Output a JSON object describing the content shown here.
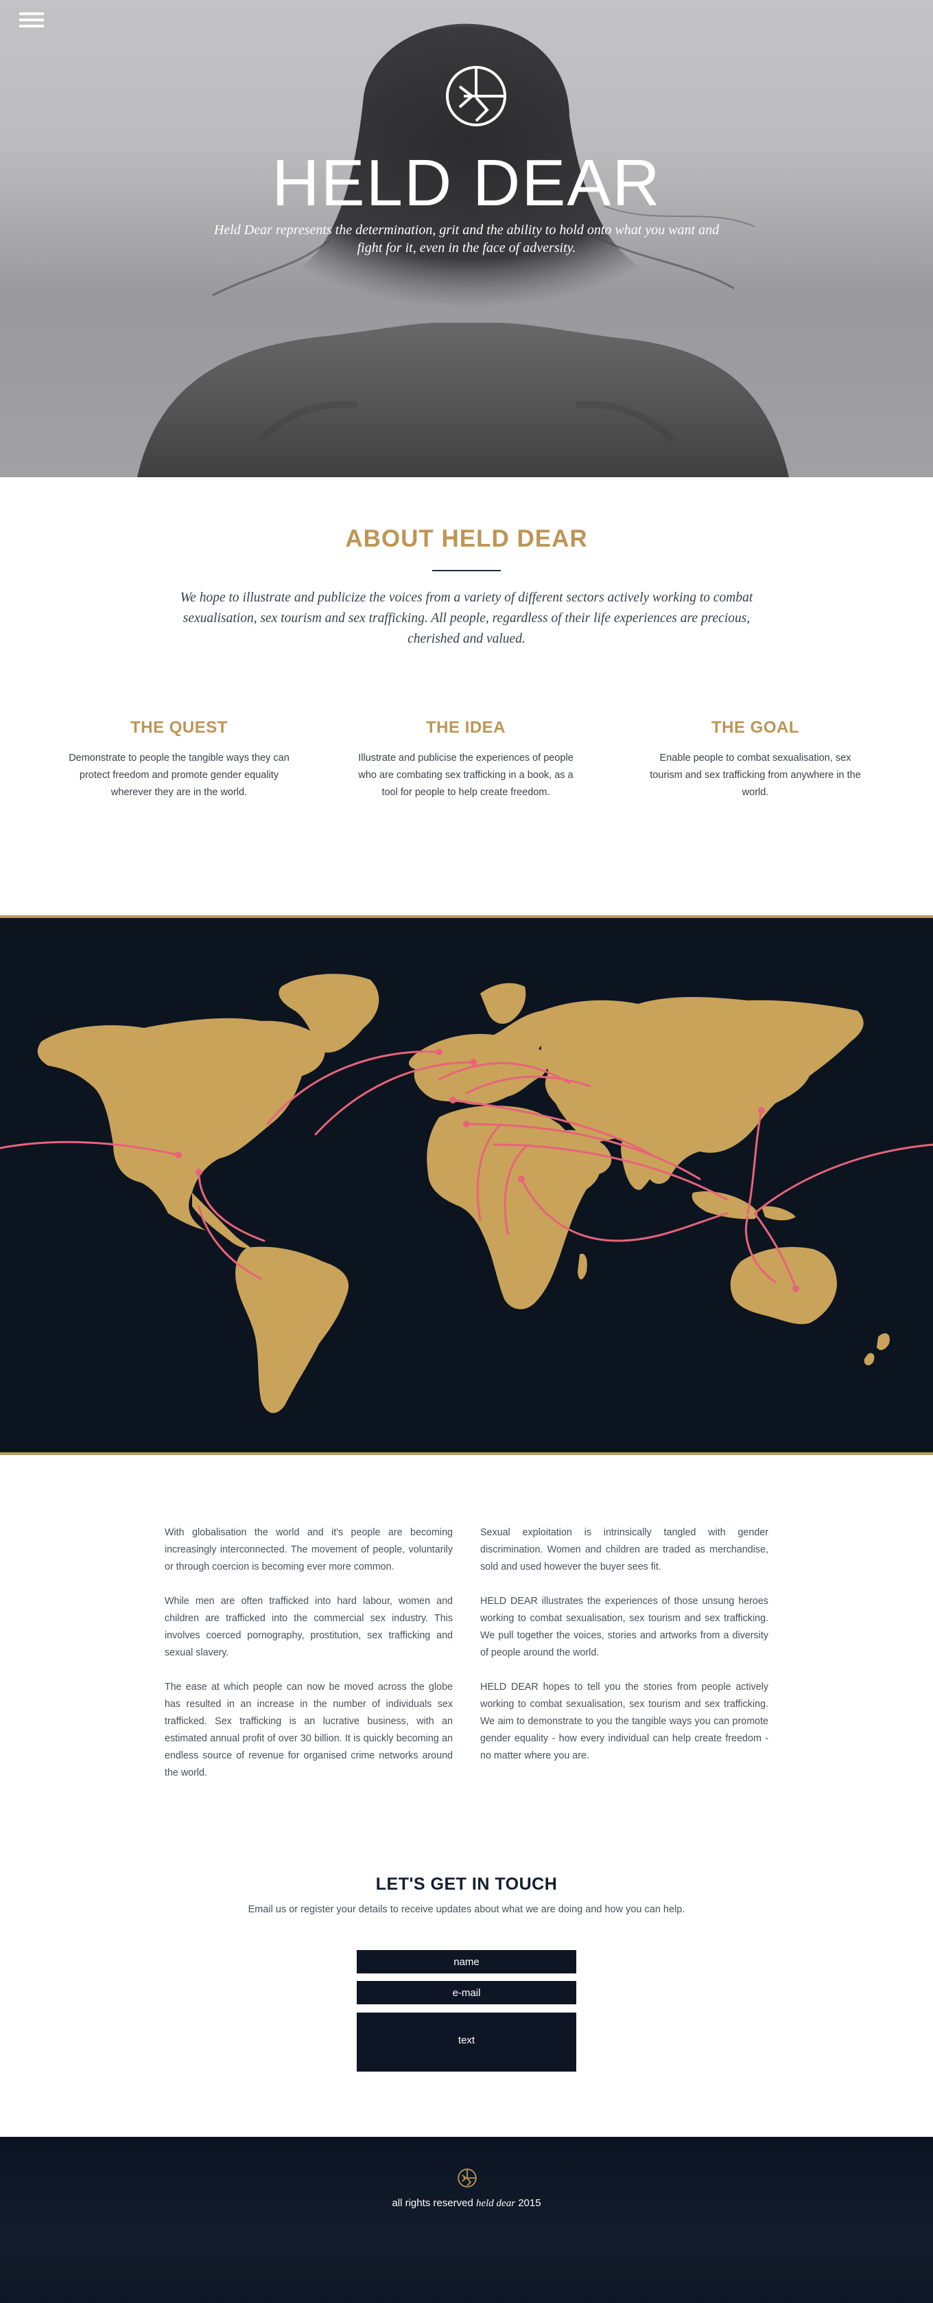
{
  "hero": {
    "title": "HELD DEAR",
    "subtitle": "Held Dear represents the determination, grit and the ability to hold onto what you want and fight for it, even in the face of adversity."
  },
  "about": {
    "title": "ABOUT HELD DEAR",
    "intro": "We hope to illustrate and publicize the voices from a variety of different sectors actively working to combat sexualisation, sex tourism and sex trafficking. All people, regardless of their life experiences are precious, cherished and valued.",
    "columns": [
      {
        "title": "THE QUEST",
        "text": "Demonstrate to people the tangible ways they can protect freedom and promote gender equality wherever they are in the world."
      },
      {
        "title": "THE IDEA",
        "text": "Illustrate and publicise the  experiences of people who are combating sex trafficking in a book, as a tool for people to help create freedom."
      },
      {
        "title": "THE GOAL",
        "text": "Enable people to combat sexualisation, sex tourism and sex trafficking from anywhere in the world."
      }
    ]
  },
  "body_text": {
    "left": [
      "With globalisation the world and it's people are becoming increasingly interconnected. The movement of people, voluntarily or through coercion is becoming ever more common.",
      "While men are often trafficked into hard labour, women and children are trafficked into the commercial sex industry. This involves coerced pornography, prostitution, sex trafficking and sexual slavery.",
      "The ease at which people can now be moved across the globe has resulted in an increase in the number of individuals sex trafficked. Sex trafficking is an lucrative business, with an estimated annual profit of over 30 billion. It is quickly becoming an endless source of revenue for organised crime networks around the world."
    ],
    "right": [
      "Sexual exploitation is intrinsically tangled with gender discrimination. Women and children are traded as merchandise, sold and used however the buyer sees fit.",
      "HELD DEAR illustrates the experiences of those unsung heroes working to combat sexualisation, sex tourism and sex trafficking. We pull together the voices, stories and artworks from a diversity of people around the world.",
      "HELD DEAR hopes to tell you the stories from people actively working to combat sexualisation, sex tourism and sex trafficking. We aim to demonstrate to you the tangible ways you can promote gender equality - how every individual can help create freedom - no matter where you are."
    ]
  },
  "contact": {
    "title": "LET'S GET IN TOUCH",
    "subtitle": "Email us or register your details to receive updates about what we are doing and how you can help.",
    "name_placeholder": "name",
    "email_placeholder": "e-mail",
    "text_placeholder": "text"
  },
  "footer": {
    "text_prefix": "all rights reserved ",
    "text_brand": "held dear",
    "text_suffix": " 2015"
  },
  "colors": {
    "gold": "#bd9555",
    "navy": "#0e1626",
    "map_land": "#c9a35a",
    "route_pink": "#e8647a"
  }
}
